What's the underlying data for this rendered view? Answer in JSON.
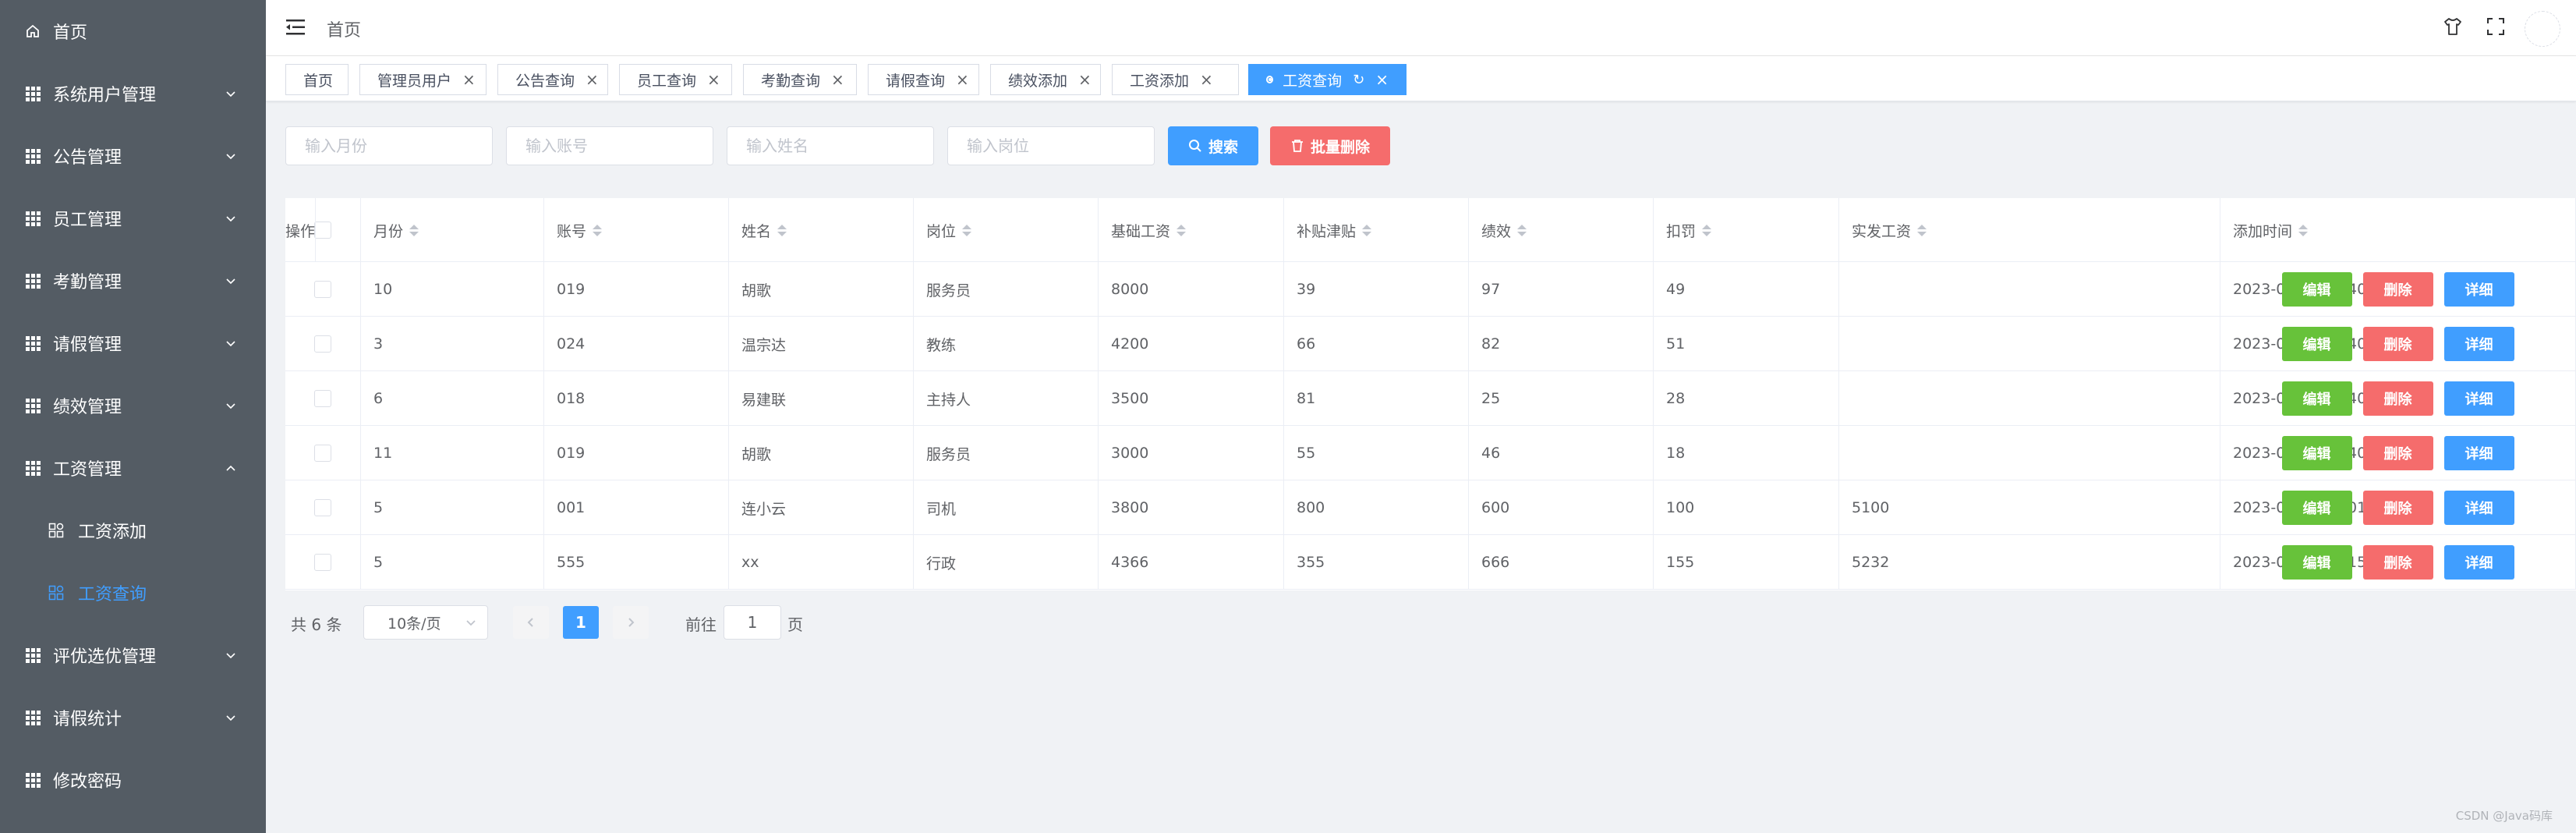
{
  "sidebar": {
    "home": "首页",
    "items": [
      {
        "label": "系统用户管理",
        "icon": "grid-icon",
        "expanded": false
      },
      {
        "label": "公告管理",
        "icon": "grid-icon",
        "expanded": false
      },
      {
        "label": "员工管理",
        "icon": "grid-icon",
        "expanded": false
      },
      {
        "label": "考勤管理",
        "icon": "grid-icon",
        "expanded": false
      },
      {
        "label": "请假管理",
        "icon": "grid-icon",
        "expanded": false
      },
      {
        "label": "绩效管理",
        "icon": "grid-icon",
        "expanded": false
      },
      {
        "label": "工资管理",
        "icon": "grid-icon",
        "expanded": true
      },
      {
        "label": "评优选优管理",
        "icon": "grid-icon",
        "expanded": false
      },
      {
        "label": "请假统计",
        "icon": "grid-icon",
        "expanded": false
      },
      {
        "label": "修改密码",
        "icon": "grid-icon",
        "expanded": false
      }
    ],
    "sub_items": [
      {
        "label": "工资添加",
        "active": false
      },
      {
        "label": "工资查询",
        "active": true
      }
    ]
  },
  "header": {
    "breadcrumb": "首页",
    "icons": [
      "hamburger-icon",
      "shirt-icon",
      "fullscreen-icon",
      "avatar"
    ]
  },
  "tabs": [
    {
      "label": "首页",
      "closable": false,
      "active": false
    },
    {
      "label": "管理员用户",
      "closable": true,
      "active": false
    },
    {
      "label": "公告查询",
      "closable": true,
      "active": false
    },
    {
      "label": "员工查询",
      "closable": true,
      "active": false
    },
    {
      "label": "考勤查询",
      "closable": true,
      "active": false
    },
    {
      "label": "请假查询",
      "closable": true,
      "active": false
    },
    {
      "label": "绩效添加",
      "closable": true,
      "active": false
    },
    {
      "label": "工资添加",
      "closable": true,
      "active": false
    },
    {
      "label": "工资查询",
      "closable": true,
      "active": true
    }
  ],
  "search": {
    "month_placeholder": "输入月份",
    "account_placeholder": "输入账号",
    "name_placeholder": "输入姓名",
    "position_placeholder": "输入岗位",
    "search_label": "搜索",
    "batch_delete_label": "批量删除"
  },
  "table": {
    "columns": [
      "月份",
      "账号",
      "姓名",
      "岗位",
      "基础工资",
      "补贴津贴",
      "绩效",
      "扣罚",
      "实发工资",
      "添加时间",
      "操作"
    ],
    "rows": [
      {
        "month": "10",
        "account": "019",
        "name": "胡歌",
        "position": "服务员",
        "base": "8000",
        "allowance": "39",
        "perf": "97",
        "penalty": "49",
        "actual": "",
        "time": "2023-05-23 02:40:41"
      },
      {
        "month": "3",
        "account": "024",
        "name": "温宗达",
        "position": "教练",
        "base": "4200",
        "allowance": "66",
        "perf": "82",
        "penalty": "51",
        "actual": "",
        "time": "2023-05-23 02:40:41"
      },
      {
        "month": "6",
        "account": "018",
        "name": "易建联",
        "position": "主持人",
        "base": "3500",
        "allowance": "81",
        "perf": "25",
        "penalty": "28",
        "actual": "",
        "time": "2023-05-23 02:40:41"
      },
      {
        "month": "11",
        "account": "019",
        "name": "胡歌",
        "position": "服务员",
        "base": "3000",
        "allowance": "55",
        "perf": "46",
        "penalty": "18",
        "actual": "",
        "time": "2023-05-23 02:40:41"
      },
      {
        "month": "5",
        "account": "001",
        "name": "连小云",
        "position": "司机",
        "base": "3800",
        "allowance": "800",
        "perf": "600",
        "penalty": "100",
        "actual": "5100",
        "time": "2023-05-23 03:01:00"
      },
      {
        "month": "5",
        "account": "555",
        "name": "xx",
        "position": "行政",
        "base": "4366",
        "allowance": "355",
        "perf": "666",
        "penalty": "155",
        "actual": "5232",
        "time": "2023-05-23 03:15:10"
      }
    ],
    "actions": {
      "edit": "编辑",
      "delete": "删除",
      "detail": "详细"
    }
  },
  "pagination": {
    "total": "共 6 条",
    "page_size": "10条/页",
    "current_page": "1",
    "goto_prefix": "前往",
    "goto_value": "1",
    "goto_suffix": "页"
  },
  "watermark": "CSDN @Java码库",
  "colors": {
    "primary": "#409eff",
    "danger": "#f56c6c",
    "success": "#67c23a",
    "sidebar": "#545c64"
  }
}
